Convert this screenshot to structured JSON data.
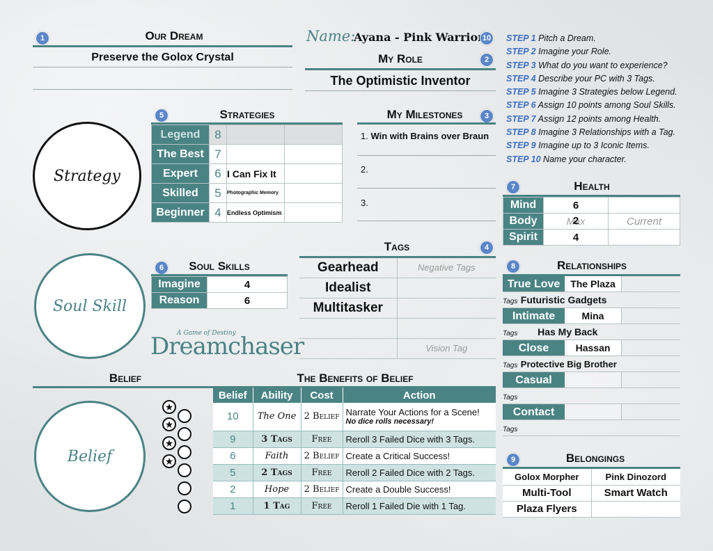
{
  "dream": {
    "step": "1",
    "title": "Our Dream",
    "value": "Preserve the Golox Crystal"
  },
  "name": {
    "label": "Name:",
    "value": "Ayana - Pink Warrior",
    "step": "10"
  },
  "role": {
    "step": "2",
    "title": "My Role",
    "value": "The Optimistic Inventor"
  },
  "steps": [
    {
      "n": "STEP 1",
      "t": "Pitch a Dream."
    },
    {
      "n": "STEP 2",
      "t": "Imagine your Role."
    },
    {
      "n": "STEP 3",
      "t": "What do you want to experience?"
    },
    {
      "n": "STEP 4",
      "t": "Describe your PC with 3 Tags."
    },
    {
      "n": "STEP 5",
      "t": "Imagine 3 Strategies below Legend."
    },
    {
      "n": "STEP 6",
      "t": "Assign 10 points among Soul Skills."
    },
    {
      "n": "STEP 7",
      "t": "Assign 12 points among Health."
    },
    {
      "n": "STEP 8",
      "t": "Imagine 3 Relationships with a Tag."
    },
    {
      "n": "STEP 9",
      "t": "Imagine up to 3 Iconic Items."
    },
    {
      "n": "STEP 10",
      "t": "Name your character."
    }
  ],
  "strategy_circle": "Strategy",
  "soul_circle": "Soul Skill",
  "belief_circle": "Belief",
  "strategies": {
    "step": "5",
    "title": "Strategies",
    "rows": [
      {
        "rank": "Legend",
        "n": "8",
        "value": ""
      },
      {
        "rank": "The Best",
        "n": "7",
        "value": ""
      },
      {
        "rank": "Expert",
        "n": "6",
        "value": "I Can Fix It"
      },
      {
        "rank": "Skilled",
        "n": "5",
        "value": "Photographic Memory"
      },
      {
        "rank": "Beginner",
        "n": "4",
        "value": "Endless Optimism"
      }
    ]
  },
  "milestones": {
    "step": "3",
    "title": "My Milestones",
    "items": [
      {
        "n": "1.",
        "text": "Win with Brains over Braun"
      },
      {
        "n": "2.",
        "text": ""
      },
      {
        "n": "3.",
        "text": ""
      }
    ]
  },
  "health": {
    "step": "7",
    "title": "Health",
    "rows": [
      {
        "label": "Mind",
        "value": "6",
        "current": ""
      },
      {
        "label": "Body",
        "value": "2",
        "current": "Current",
        "max": "Max"
      },
      {
        "label": "Spirit",
        "value": "4",
        "current": ""
      }
    ]
  },
  "tags": {
    "step": "4",
    "title": "Tags",
    "items": [
      "Gearhead",
      "Idealist",
      "Multitasker",
      "",
      ""
    ],
    "negative": "Negative Tags",
    "vision": "Vision Tag"
  },
  "soul_skills": {
    "step": "6",
    "title": "Soul Skills",
    "rows": [
      {
        "label": "Imagine",
        "value": "4"
      },
      {
        "label": "Reason",
        "value": "6"
      }
    ]
  },
  "logo": {
    "tagline": "A Game of Destiny",
    "name": "Dreamchaser"
  },
  "relationships": {
    "step": "8",
    "title": "Relationships",
    "tags_label": "Tags",
    "rows": [
      {
        "level": "True Love",
        "name": "The Plaza",
        "tag": "Futuristic Gadgets"
      },
      {
        "level": "Intimate",
        "name": "Mina",
        "tag": "Has My Back"
      },
      {
        "level": "Close",
        "name": "Hassan",
        "tag": "Protective Big Brother"
      },
      {
        "level": "Casual",
        "name": "",
        "tag": ""
      },
      {
        "level": "Contact",
        "name": "",
        "tag": ""
      }
    ]
  },
  "belongings": {
    "step": "9",
    "title": "Belongings",
    "items": [
      "Golox Morpher",
      "Pink Dinozord",
      "Multi-Tool",
      "Smart Watch",
      "Plaza Flyers",
      ""
    ]
  },
  "belief": {
    "title": "Belief",
    "benefits_title": "The Benefits of Belief",
    "headers": [
      "Belief",
      "Ability",
      "Cost",
      "Action"
    ],
    "rows": [
      {
        "belief": "10",
        "ability": "The One",
        "cost": "2 Belief",
        "action": "Narrate Your Actions for a Scene!",
        "action2": "No dice rolls necessary!"
      },
      {
        "belief": "9",
        "ability": "3 Tags",
        "cost": "Free",
        "action": "Reroll 3 Failed Dice with 3 Tags."
      },
      {
        "belief": "6",
        "ability": "Faith",
        "cost": "2 Belief",
        "action": "Create a Critical Success!"
      },
      {
        "belief": "5",
        "ability": "2 Tags",
        "cost": "Free",
        "action": "Reroll 2 Failed Dice with 2 Tags."
      },
      {
        "belief": "2",
        "ability": "Hope",
        "cost": "2 Belief",
        "action": "Create a Double Success!"
      },
      {
        "belief": "1",
        "ability": "1 Tag",
        "cost": "Free",
        "action": "Reroll 1 Failed Die with 1 Tag."
      }
    ],
    "tokens_filled": 4,
    "star_symbol": "★"
  }
}
